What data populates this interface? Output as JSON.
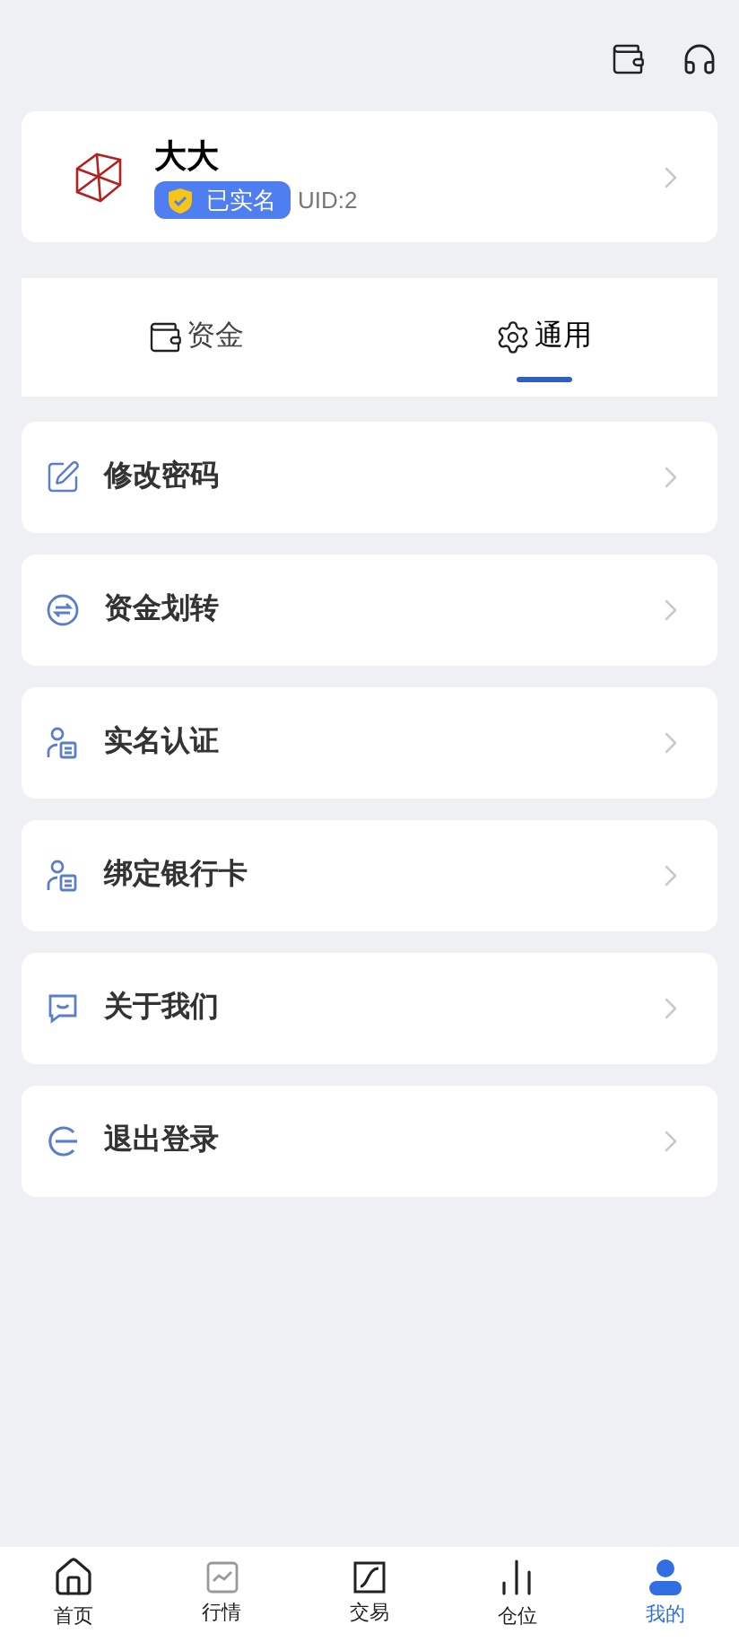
{
  "profile": {
    "name": "大大",
    "verified_badge": "已实名",
    "uid": "UID:2"
  },
  "tabs": [
    {
      "label": "资金",
      "selected": false
    },
    {
      "label": "通用",
      "selected": true
    }
  ],
  "menu": [
    "修改密码",
    "资金划转",
    "实名认证",
    "绑定银行卡",
    "关于我们",
    "退出登录"
  ],
  "nav": [
    {
      "label": "首页",
      "selected": false
    },
    {
      "label": "行情",
      "selected": false
    },
    {
      "label": "交易",
      "selected": false
    },
    {
      "label": "仓位",
      "selected": false
    },
    {
      "label": "我的",
      "selected": true
    }
  ]
}
